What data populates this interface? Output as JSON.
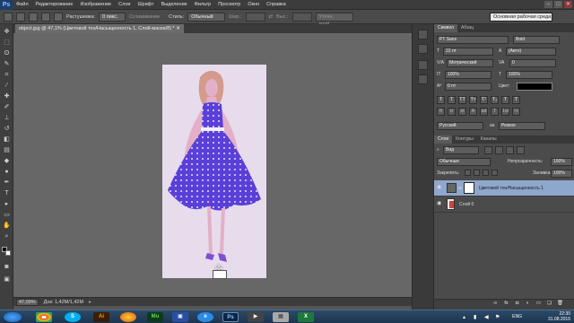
{
  "app": {
    "logo": "Ps",
    "menu": [
      "Файл",
      "Редактирование",
      "Изображение",
      "Слои",
      "Шрифт",
      "Выделение",
      "Фильтр",
      "Просмотр",
      "Окно",
      "Справка"
    ],
    "window_controls": [
      "–",
      "□",
      "✕"
    ]
  },
  "options": {
    "feather_label": "Растушевка:",
    "feather_value": "0 пикс.",
    "antialias_label": "Сглаживание",
    "style_label": "Стиль:",
    "style_value": "Обычный",
    "width_label": "Шир.:",
    "height_label": "Выс.:",
    "refine_edge": "Уточн. край...",
    "workspace": "Основная рабочая среда"
  },
  "document": {
    "tab_title": "object.jpg @ 47,1% (Цветовой тон/Насыщенность 1, Слой-маска/8) * ✕",
    "zoom": "47,09%",
    "doc_info": "Док: 1,42M/1,42M"
  },
  "character_panel": {
    "tabs": [
      "Символ",
      "Абзац"
    ],
    "font_family": "PT Sans",
    "font_style": "Bold",
    "font_size": "22 пт",
    "leading": "(Авто)",
    "kerning": "Метрический",
    "tracking": "0",
    "vertical_scale": "100%",
    "horizontal_scale": "100%",
    "baseline": "0 пт",
    "color_label": "Цвет:",
    "style_buttons": [
      "T",
      "T",
      "TT",
      "Tт",
      "T¹",
      "T₁",
      "T",
      "T"
    ],
    "feature_buttons": [
      "fi",
      "σ",
      "st",
      "A",
      "ad",
      "T",
      "1st",
      "½"
    ],
    "language": "Русский",
    "antialias": "Резкое",
    "aa_prefix": "aa"
  },
  "layers_panel": {
    "tabs": [
      "Слои",
      "Контуры",
      "Каналы"
    ],
    "filter_label": "Вид",
    "blend_mode": "Обычные",
    "opacity_label": "Непрозрачность:",
    "opacity_value": "100%",
    "lock_label": "Закрепить:",
    "fill_label": "Заливка:",
    "fill_value": "100%",
    "layers": [
      {
        "name": "Цветовой тон/Насыщенность 1",
        "selected": true
      },
      {
        "name": "Слой 0",
        "selected": false
      }
    ],
    "footer_icons": [
      "link-icon",
      "fx-icon",
      "mask-icon",
      "adjustment-icon",
      "folder-icon",
      "new-layer-icon",
      "trash-icon"
    ]
  },
  "taskbar": {
    "apps": [
      "chrome",
      "skype",
      "Ai",
      "firefox",
      "Mu",
      "save",
      "ie",
      "Ps",
      "video",
      "film",
      "Х"
    ],
    "language": "ENG",
    "time": "22:30",
    "date": "31.08.2016"
  },
  "colors": {
    "dress": "#5a3fd8",
    "skin_tint": "#d7a0c9",
    "bg_tint": "#e7dcec",
    "layer_selected": "#8ea7cc"
  }
}
